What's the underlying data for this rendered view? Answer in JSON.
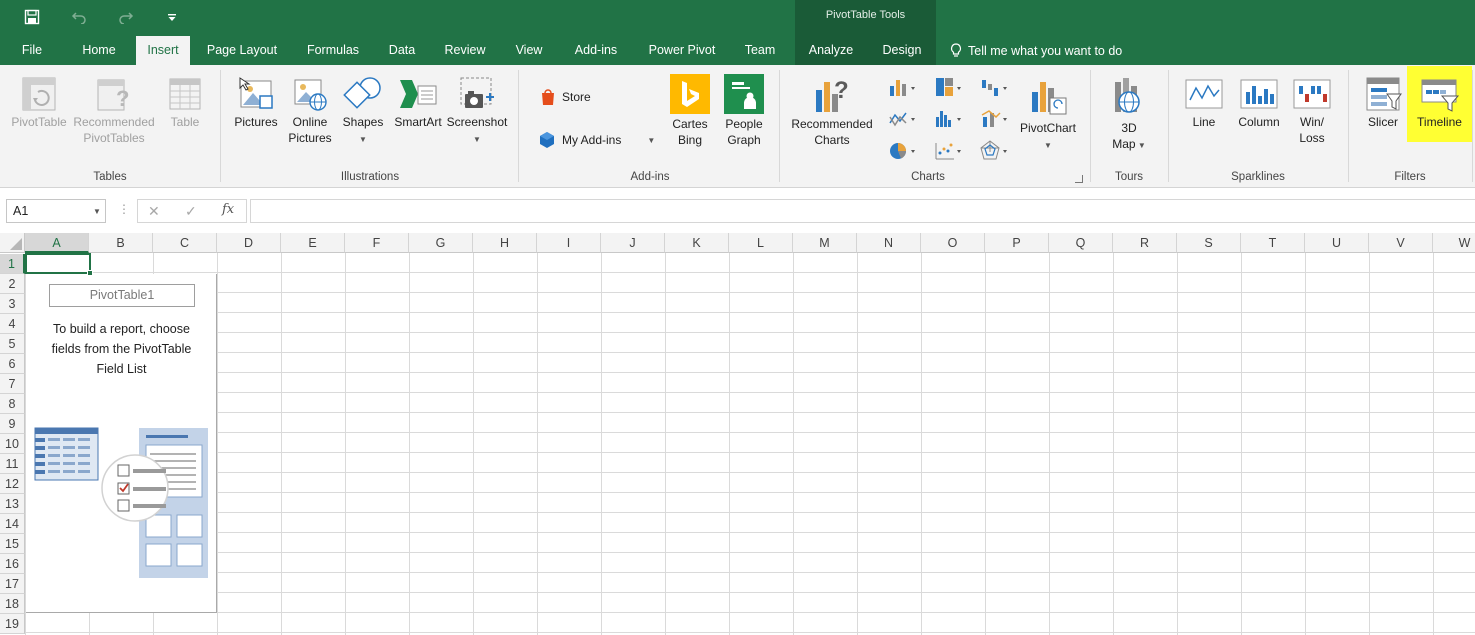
{
  "quick_access": {
    "save_icon": "save-icon",
    "undo_icon": "undo-icon",
    "redo_icon": "redo-icon",
    "customize_icon": "customize-qat-icon"
  },
  "context_title": "PivotTable Tools",
  "tabs": {
    "file": "File",
    "home": "Home",
    "insert": "Insert",
    "page_layout": "Page Layout",
    "formulas": "Formulas",
    "data": "Data",
    "review": "Review",
    "view": "View",
    "addins": "Add-ins",
    "power_pivot": "Power Pivot",
    "team": "Team",
    "analyze": "Analyze",
    "design": "Design"
  },
  "tell_me": "Tell me what you want to do",
  "ribbon": {
    "tables": {
      "label": "Tables",
      "pivottable": "PivotTable",
      "recommended_1": "Recommended",
      "recommended_2": "PivotTables",
      "table": "Table"
    },
    "illustrations": {
      "label": "Illustrations",
      "pictures": "Pictures",
      "online_1": "Online",
      "online_2": "Pictures",
      "shapes": "Shapes",
      "smartart": "SmartArt",
      "screenshot": "Screenshot"
    },
    "addins": {
      "label": "Add-ins",
      "store": "Store",
      "my_addins": "My Add-ins",
      "cartes_1": "Cartes",
      "cartes_2": "Bing",
      "people_1": "People",
      "people_2": "Graph"
    },
    "charts": {
      "label": "Charts",
      "recommended_1": "Recommended",
      "recommended_2": "Charts",
      "pivotchart": "PivotChart"
    },
    "tours": {
      "label": "Tours",
      "map_1": "3D",
      "map_2": "Map"
    },
    "sparklines": {
      "label": "Sparklines",
      "line": "Line",
      "column": "Column",
      "winloss_1": "Win/",
      "winloss_2": "Loss"
    },
    "filters": {
      "label": "Filters",
      "slicer": "Slicer",
      "timeline": "Timeline"
    }
  },
  "formula_bar": {
    "name_box": "A1",
    "cancel_glyph": "✕",
    "enter_glyph": "✓",
    "fx": "fx",
    "value": ""
  },
  "columns": [
    "A",
    "B",
    "C",
    "D",
    "E",
    "F",
    "G",
    "H",
    "I",
    "J",
    "K",
    "L",
    "M",
    "N",
    "O",
    "P",
    "Q",
    "R",
    "S",
    "T",
    "U",
    "V",
    "W"
  ],
  "rows": [
    "1",
    "2",
    "3",
    "4",
    "5",
    "6",
    "7",
    "8",
    "9",
    "10",
    "11",
    "12",
    "13",
    "14",
    "15",
    "16",
    "17",
    "18",
    "19"
  ],
  "pivot": {
    "name": "PivotTable1",
    "instr_1": "To build a report, choose",
    "instr_2": "fields from the PivotTable",
    "instr_3": "Field List"
  },
  "colors": {
    "excel_green": "#217346",
    "context_green": "#1a5b37",
    "highlight": "#ffff33"
  }
}
